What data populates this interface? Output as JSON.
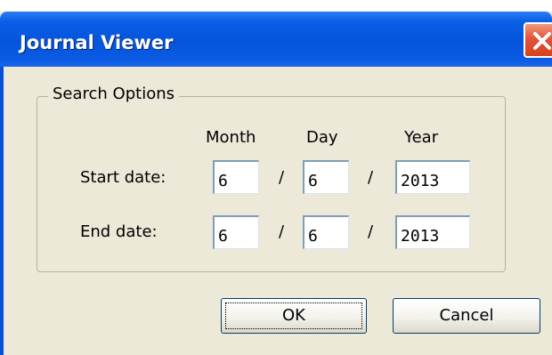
{
  "window": {
    "title": "Journal Viewer"
  },
  "search_options": {
    "group_label": "Search Options",
    "headers": {
      "month": "Month",
      "day": "Day",
      "year": "Year"
    },
    "separator": "/",
    "start_date": {
      "label": "Start date:",
      "month": "6",
      "day": "6",
      "year": "2013"
    },
    "end_date": {
      "label": "End date:",
      "month": "6",
      "day": "6",
      "year": "2013"
    }
  },
  "buttons": {
    "ok_label": "OK",
    "cancel_label": "Cancel"
  },
  "icons": {
    "close": "close-icon"
  },
  "colors": {
    "titlebar": "#0554dc",
    "dialog_background": "#ece9d8",
    "close_button": "#e2543a"
  }
}
